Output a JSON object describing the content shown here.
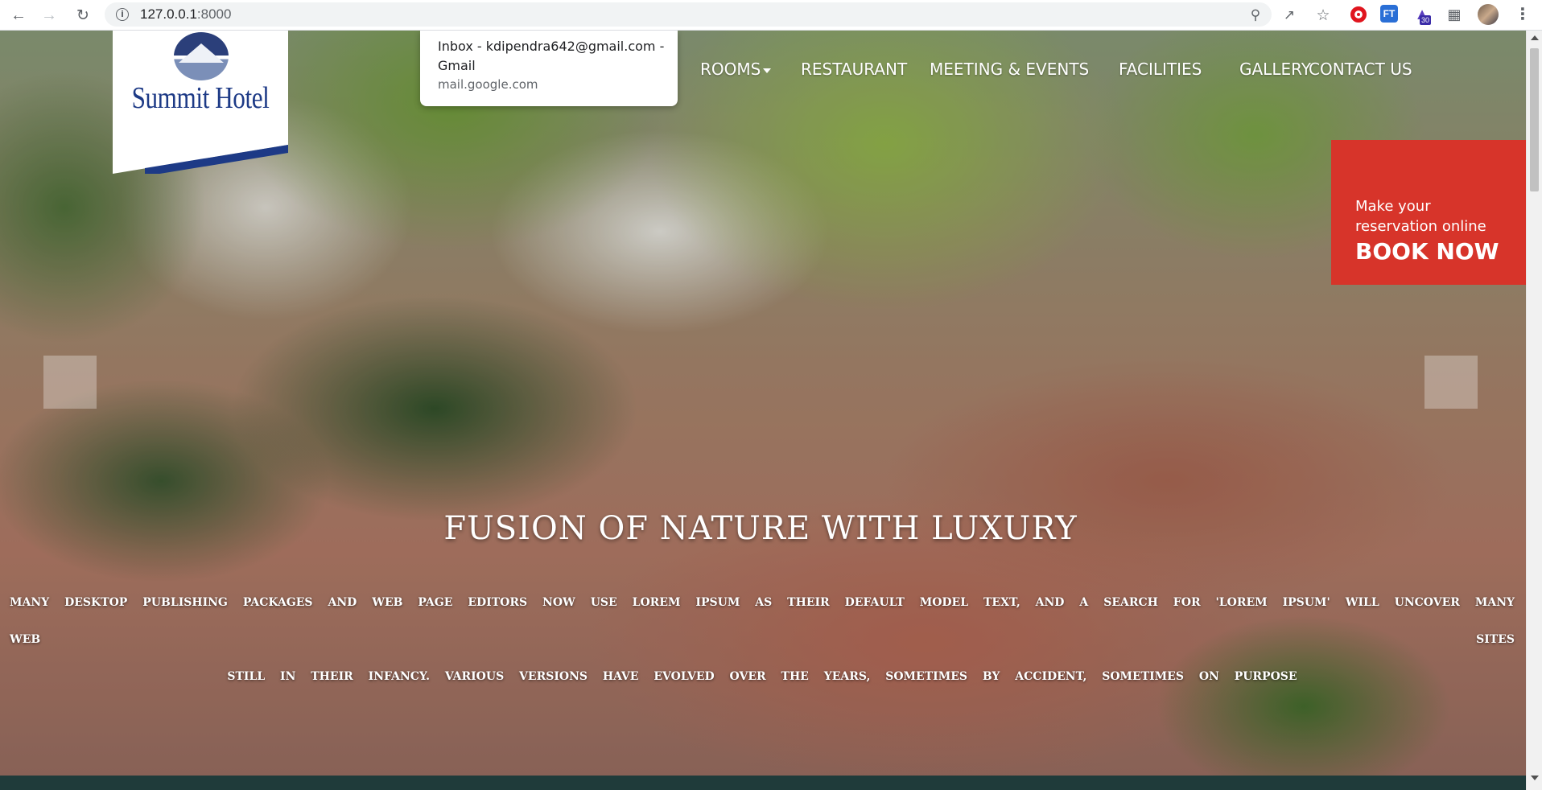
{
  "browser": {
    "url_host": "127.0.0.1",
    "url_port": ":8000",
    "extension_badge": "30",
    "ft_label": "FT"
  },
  "tooltip": {
    "title": "Inbox - kdipendra642@gmail.com - Gmail",
    "domain": "mail.google.com"
  },
  "logo": {
    "name": "Summit Hotel"
  },
  "nav": {
    "rooms": "ROOMS",
    "restaurant": "RESTAURANT",
    "meetings": "MEETING & EVENTS",
    "facilities": "FACILITIES",
    "gallery": "GALLERY",
    "contact": "CONTACT US"
  },
  "booking": {
    "subtitle": "Make your reservation online",
    "cta": "BOOK NOW"
  },
  "hero": {
    "title": "FUSION OF NATURE WITH LUXURY",
    "description_line1": "Many desktop publishing packages and web page editors now use Lorem Ipsum as their default model text, and a search for 'lorem ipsum' will uncover many web sites",
    "description_line2": "still in their infancy. Various versions have evolved over the years, sometimes by accident, sometimes on purpose"
  },
  "colors": {
    "brand_blue": "#1d3a86",
    "book_red": "#d7342a",
    "footer_teal": "#1f3b3a"
  },
  "icons": [
    "back-arrow-icon",
    "forward-arrow-icon",
    "reload-icon",
    "info-icon",
    "zoom-icon",
    "share-icon",
    "star-icon",
    "opera-icon",
    "ft-extension-icon",
    "graduation-cap-icon",
    "puzzle-icon",
    "avatar",
    "more-vert-icon"
  ]
}
